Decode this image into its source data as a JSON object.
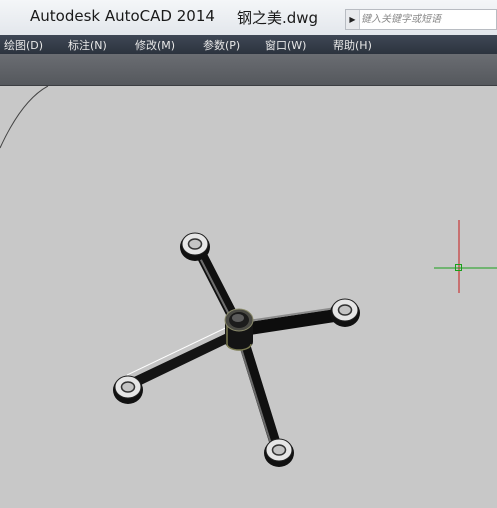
{
  "titlebar": {
    "app_title": "Autodesk AutoCAD 2014",
    "filename": "钢之美.dwg"
  },
  "search": {
    "arrow_icon": "triangle-right-icon",
    "placeholder": "键入关键字或短语"
  },
  "menu": {
    "items": [
      {
        "label": "绘图(D)"
      },
      {
        "label": "标注(N)"
      },
      {
        "label": "修改(M)"
      },
      {
        "label": "参数(P)"
      },
      {
        "label": "窗口(W)"
      },
      {
        "label": "帮助(H)"
      }
    ]
  },
  "colors": {
    "viewport_bg": "#c8c8c8",
    "menubar_bg": "#343b47",
    "ucs_x_axis": "#1aa01a",
    "ucs_y_axis": "#c81a1a"
  }
}
